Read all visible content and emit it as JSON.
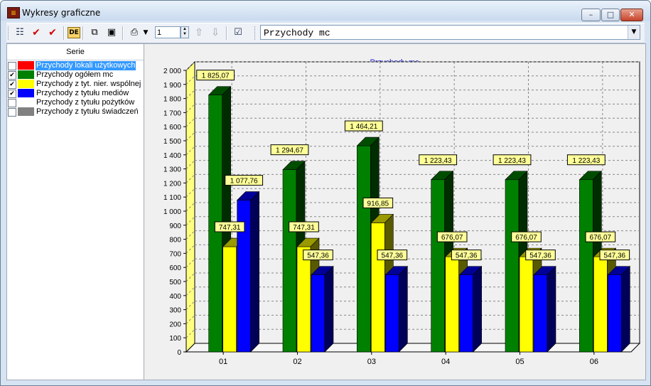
{
  "window": {
    "title": "Wykresy graficzne",
    "icon": "app-chart-icon",
    "controls": [
      "minimize-icon",
      "maximize-icon",
      "close-icon"
    ]
  },
  "toolbar": {
    "spin_value": "1",
    "combo_value": "Przychody mc",
    "icons": [
      "list-icon",
      "check-all-icon",
      "check-select-icon",
      "deselect-icon",
      "copy-icon",
      "save-icon",
      "print-icon",
      "move-up-icon",
      "move-down-icon",
      "properties-icon"
    ]
  },
  "series_panel": {
    "header": "Serie",
    "items": [
      {
        "label": "Przychody lokali użytkowych",
        "color": "#ff0000",
        "checked": false,
        "selected": true
      },
      {
        "label": "Przychody ogółem mc",
        "color": "#008000",
        "checked": true,
        "selected": false
      },
      {
        "label": "Przychody z tyt. nier. wspólnej",
        "color": "#ffff00",
        "checked": true,
        "selected": false
      },
      {
        "label": "Przychody z tytułu mediów",
        "color": "#0000ff",
        "checked": true,
        "selected": false
      },
      {
        "label": "Przychody z tytułu pożytków",
        "color": "#ffffff",
        "checked": false,
        "selected": false
      },
      {
        "label": "Przychody z tytułu świadczeń",
        "color": "#808080",
        "checked": false,
        "selected": false
      }
    ]
  },
  "chart_data": {
    "type": "bar",
    "title": "Przychody mc",
    "categories": [
      "01",
      "02",
      "03",
      "04",
      "05",
      "06"
    ],
    "ylim": [
      0,
      2000
    ],
    "yticks": [
      "0",
      "100",
      "200",
      "300",
      "400",
      "500",
      "600",
      "700",
      "800",
      "900",
      "1 000",
      "1 100",
      "1 200",
      "1 300",
      "1 400",
      "1 500",
      "1 600",
      "1 700",
      "1 800",
      "1 900",
      "2 000"
    ],
    "grid": true,
    "series": [
      {
        "name": "Przychody ogółem mc",
        "color": "#008000",
        "values": [
          1825.07,
          1294.67,
          1464.21,
          1223.43,
          1223.43,
          1223.43
        ],
        "labels": [
          "1 825,07",
          "1 294,67",
          "1 464,21",
          "1 223,43",
          "1 223,43",
          "1 223,43"
        ]
      },
      {
        "name": "Przychody z tyt. nier. wspólnej",
        "color": "#ffff00",
        "values": [
          747.31,
          747.31,
          916.85,
          676.07,
          676.07,
          676.07
        ],
        "labels": [
          "747,31",
          "747,31",
          "916,85",
          "676,07",
          "676,07",
          "676,07"
        ]
      },
      {
        "name": "Przychody z tytułu mediów",
        "color": "#0000ff",
        "values": [
          1077.76,
          547.36,
          547.36,
          547.36,
          547.36,
          547.36
        ],
        "labels": [
          "1 077,76",
          "547,36",
          "547,36",
          "547,36",
          "547,36",
          "547,36"
        ]
      }
    ]
  }
}
